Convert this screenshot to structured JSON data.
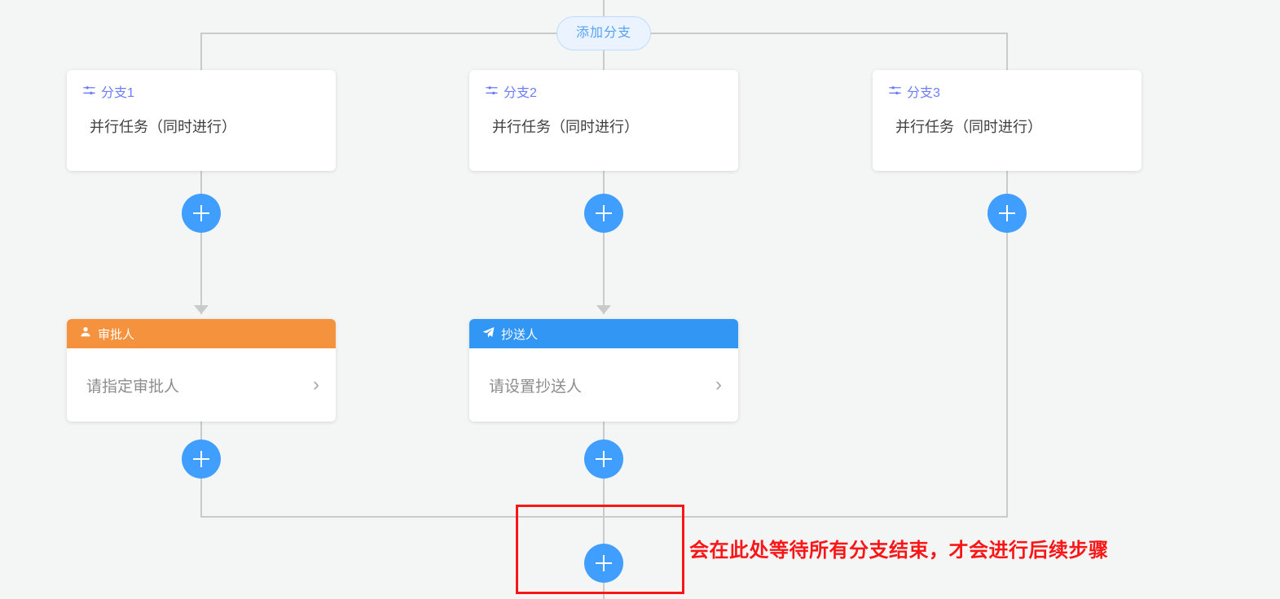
{
  "canvas": {
    "background_color": "#f4f6f5",
    "connector_color": "#cacaca"
  },
  "add_branch": {
    "label": "添加分支",
    "color": "#57a3f3",
    "background": "#eaf3ff"
  },
  "branches": [
    {
      "icon": "sliders-icon",
      "title": "分支1",
      "body": "并行任务（同时进行）",
      "title_color": "#6b7cff"
    },
    {
      "icon": "sliders-icon",
      "title": "分支2",
      "body": "并行任务（同时进行）",
      "title_color": "#6b7cff"
    },
    {
      "icon": "sliders-icon",
      "title": "分支3",
      "body": "并行任务（同时进行）",
      "title_color": "#6b7cff"
    }
  ],
  "nodes": {
    "approver": {
      "icon": "person-icon",
      "header_label": "审批人",
      "header_color": "#f5923e",
      "value": "请指定审批人",
      "chevron": "›"
    },
    "cc": {
      "icon": "paper-plane-icon",
      "header_label": "抄送人",
      "header_color": "#3296f5",
      "value": "请设置抄送人",
      "chevron": "›"
    }
  },
  "plus_buttons": {
    "label": "+",
    "color": "#409eff",
    "count": 6
  },
  "annotation": {
    "text": "会在此处等待所有分支结束，才会进行后续步骤",
    "color": "#fa1616",
    "highlight_border_color": "#fa1616"
  }
}
